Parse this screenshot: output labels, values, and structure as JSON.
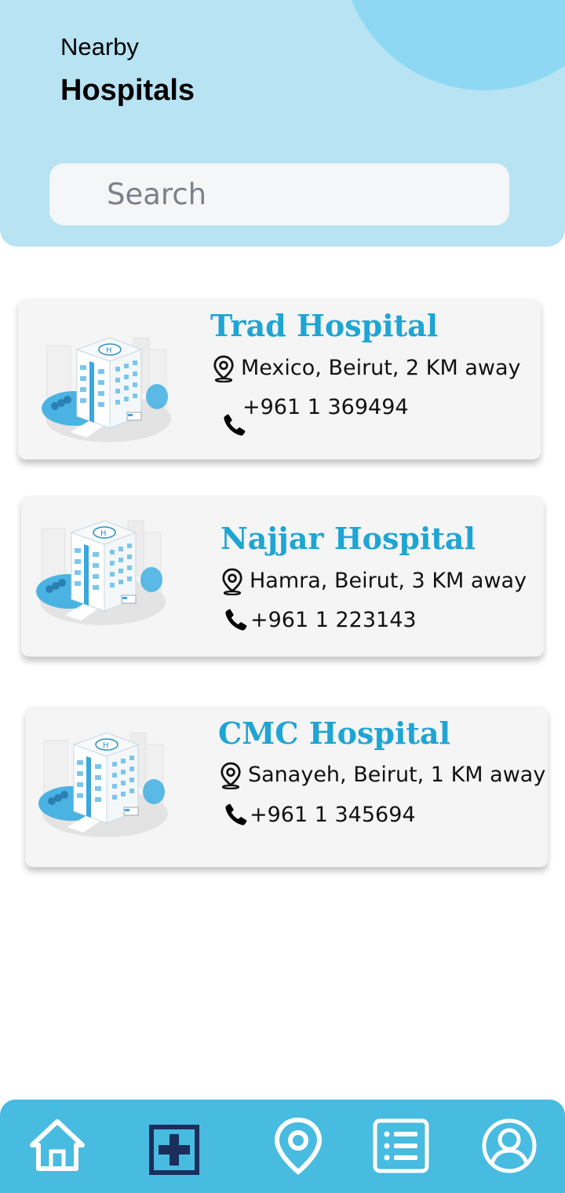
{
  "header": {
    "subtitle": "Nearby",
    "title": "Hospitals",
    "search_placeholder": "Search"
  },
  "hospitals": [
    {
      "name": "Trad Hospital",
      "address": "Mexico, Beirut, 2 KM away",
      "phone": "+961 1 369494"
    },
    {
      "name": "Najjar Hospital",
      "address": "Hamra, Beirut, 3 KM away",
      "phone": "+961 1 223143"
    },
    {
      "name": "CMC Hospital",
      "address": "Sanayeh, Beirut, 1 KM away",
      "phone": "+961 1 345694"
    }
  ],
  "nav": {
    "items": [
      {
        "icon": "home-icon"
      },
      {
        "icon": "hospital-icon",
        "active": true
      },
      {
        "icon": "map-pin-icon"
      },
      {
        "icon": "list-icon"
      },
      {
        "icon": "profile-icon"
      }
    ]
  },
  "colors": {
    "header_bg": "#b7e3f3",
    "header_circle": "#8fd8f4",
    "hospital_name": "#1ea5d3",
    "nav_bg": "#48bbe0",
    "nav_active_icon": "#1a2f5c",
    "card_bg": "#f5f5f5"
  }
}
